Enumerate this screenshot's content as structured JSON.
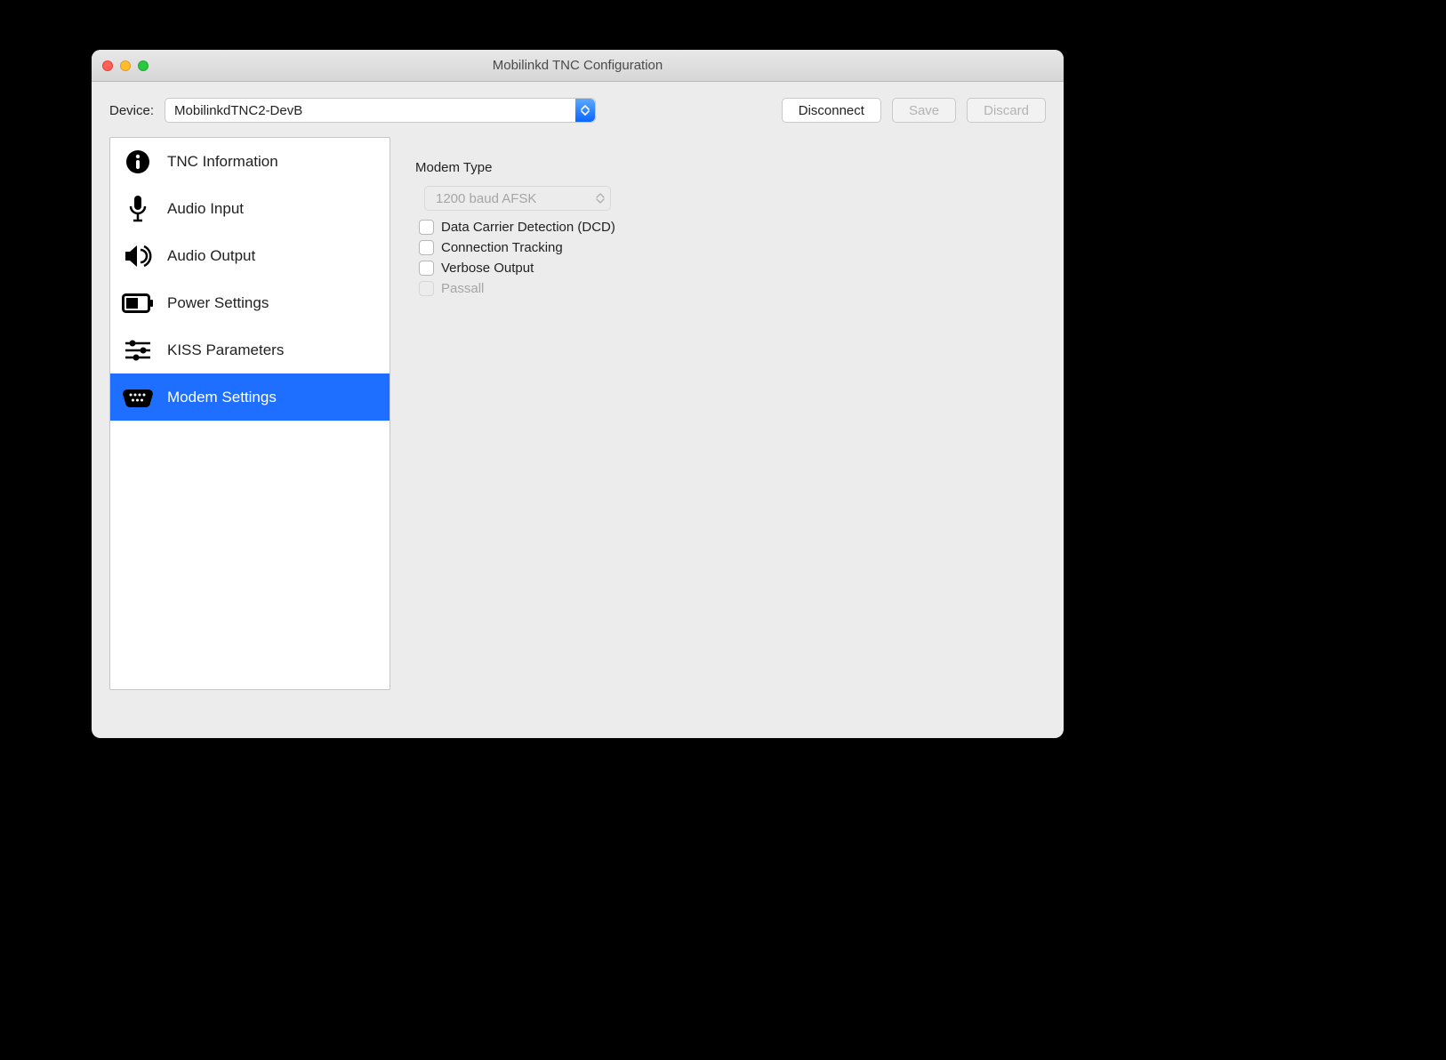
{
  "window": {
    "title": "Mobilinkd TNC Configuration"
  },
  "toolbar": {
    "device_label": "Device:",
    "device_value": "MobilinkdTNC2-DevB",
    "disconnect": "Disconnect",
    "save": "Save",
    "discard": "Discard"
  },
  "sidebar": {
    "items": [
      {
        "label": "TNC Information",
        "icon": "info-icon",
        "selected": false
      },
      {
        "label": "Audio Input",
        "icon": "mic-icon",
        "selected": false
      },
      {
        "label": "Audio Output",
        "icon": "speaker-icon",
        "selected": false
      },
      {
        "label": "Power Settings",
        "icon": "battery-icon",
        "selected": false
      },
      {
        "label": "KISS Parameters",
        "icon": "sliders-icon",
        "selected": false
      },
      {
        "label": "Modem Settings",
        "icon": "serial-port-icon",
        "selected": true
      }
    ]
  },
  "panel": {
    "section_title": "Modem Type",
    "modem_type_value": "1200 baud AFSK",
    "checks": {
      "dcd": "Data Carrier Detection (DCD)",
      "conn_track": "Connection Tracking",
      "verbose": "Verbose Output",
      "passall": "Passall"
    }
  }
}
